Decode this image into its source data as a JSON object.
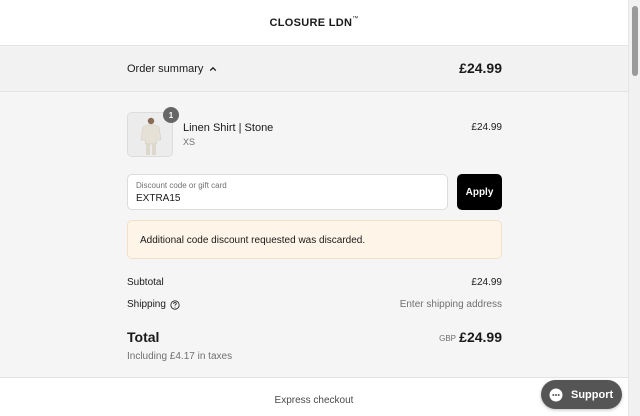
{
  "header": {
    "brand": "CLOSURE LDN",
    "brand_mark": "™"
  },
  "summary": {
    "label": "Order summary",
    "total": "£24.99"
  },
  "product": {
    "name": "Linen Shirt | Stone",
    "variant": "XS",
    "price": "£24.99",
    "quantity": "1"
  },
  "discount": {
    "placeholder": "Discount code or gift card",
    "value": "EXTRA15",
    "apply_label": "Apply"
  },
  "notice": {
    "message": "Additional code discount requested was discarded."
  },
  "totals": {
    "subtotal_label": "Subtotal",
    "subtotal_value": "£24.99",
    "shipping_label": "Shipping",
    "shipping_value": "Enter shipping address",
    "total_label": "Total",
    "currency": "GBP",
    "total_value": "£24.99",
    "taxes": "Including £4.17 in taxes"
  },
  "footer": {
    "express": "Express checkout"
  },
  "support": {
    "label": "Support"
  },
  "icons": {
    "summary_toggle": "chevron-up-icon",
    "shipping_help": "question-circle-icon",
    "support": "chat-bubble-icon"
  },
  "colors": {
    "apply_bg": "#000000",
    "notice_bg": "#fff4e8",
    "support_bg": "#555555"
  }
}
